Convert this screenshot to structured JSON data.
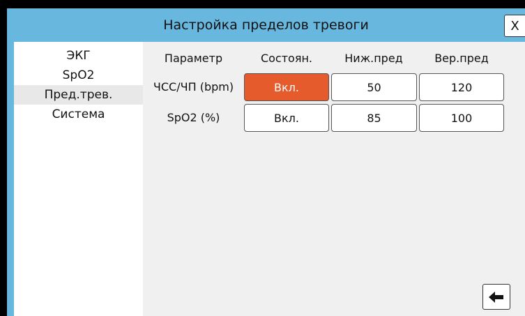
{
  "window": {
    "title": "Настройка пределов тревоги",
    "close_label": "X"
  },
  "sidebar": {
    "items": [
      {
        "label": "ЭКГ",
        "active": false
      },
      {
        "label": "SpO2",
        "active": false
      },
      {
        "label": "Пред.трев.",
        "active": true
      },
      {
        "label": "Система",
        "active": false
      }
    ]
  },
  "table": {
    "headers": [
      "Параметр",
      "Состоян.",
      "Ниж.пред",
      "Вер.пред"
    ],
    "rows": [
      {
        "param": "ЧСС/ЧП (bpm)",
        "state": "Вкл.",
        "state_on": true,
        "low": "50",
        "high": "120"
      },
      {
        "param": "SpO2 (%)",
        "state": "Вкл.",
        "state_on": false,
        "low": "85",
        "high": "100"
      }
    ]
  },
  "colors": {
    "accent": "#67b7de",
    "active_state": "#e55b2b"
  },
  "icons": {
    "back": "arrow-left-icon"
  }
}
